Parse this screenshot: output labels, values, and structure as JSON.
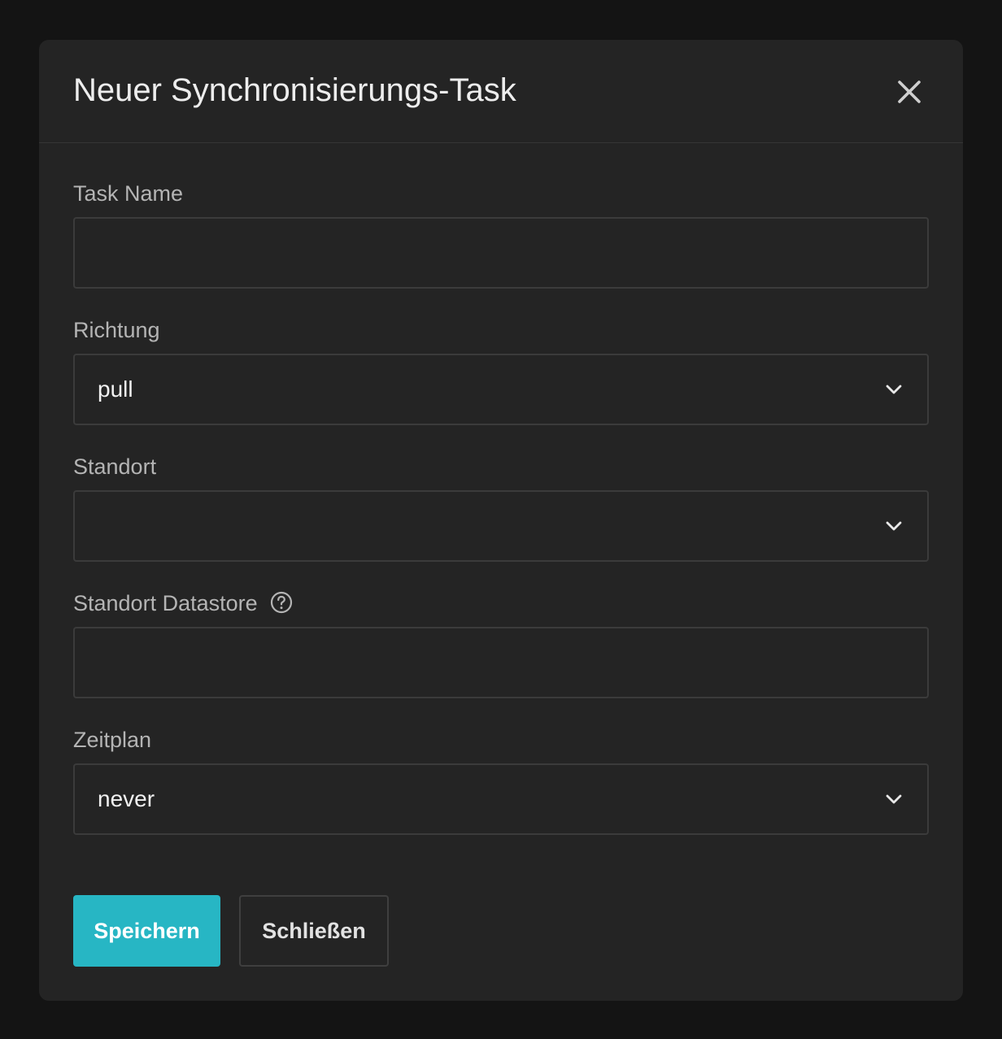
{
  "dialog": {
    "title": "Neuer Synchronisierungs-Task",
    "close_icon": "close-icon"
  },
  "form": {
    "task_name": {
      "label": "Task Name",
      "value": "",
      "placeholder": ""
    },
    "direction": {
      "label": "Richtung",
      "selected": "pull"
    },
    "location": {
      "label": "Standort",
      "selected": ""
    },
    "location_datastore": {
      "label": "Standort Datastore",
      "value": "",
      "help_icon": "help-circle-icon"
    },
    "schedule": {
      "label": "Zeitplan",
      "selected": "never"
    }
  },
  "actions": {
    "save_label": "Speichern",
    "close_label": "Schließen"
  },
  "colors": {
    "backdrop": "#141414",
    "dialog_bg": "#242424",
    "accent": "#27b6c4",
    "border": "#3b3b3b"
  }
}
